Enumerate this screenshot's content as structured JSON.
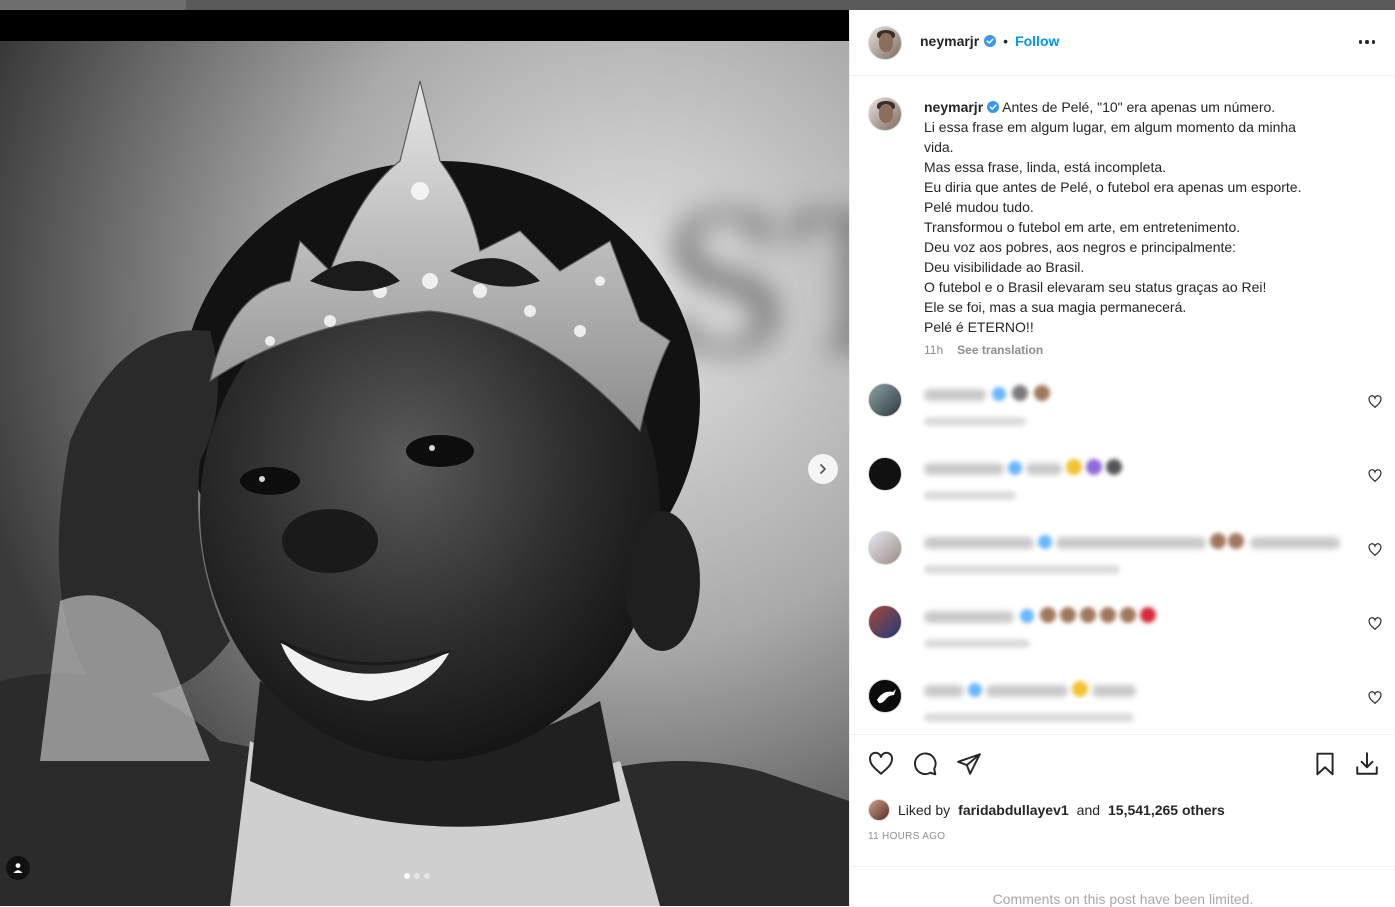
{
  "post": {
    "username": "neymarjr",
    "follow_label": "Follow",
    "separator": "•",
    "caption_lines": [
      "Antes de Pelé, \"10\" era apenas um número.",
      "Li essa frase em algum lugar, em algum momento da minha",
      "vida.",
      "Mas essa frase, linda, está incompleta.",
      "Eu diria que antes de Pelé, o futebol era apenas um esporte.",
      "Pelé mudou tudo.",
      "Transformou o futebol em arte, em entretenimento.",
      "Deu voz aos pobres, aos negros e principalmente:",
      "Deu visibilidade ao Brasil.",
      "O futebol e o Brasil elevaram seu status graças ao Rei!",
      "Ele se foi, mas a sua magia permanecerá.",
      "Pelé é ETERNO!!"
    ],
    "caption_time": "11h",
    "see_translation": "See translation",
    "liked_prefix": "Liked by",
    "liked_user": "faridabdullayev1",
    "liked_and": "and",
    "liked_count": "15,541,265 others",
    "time_ago": "11 HOURS AGO",
    "comments_limited": "Comments on this post have been limited."
  },
  "media": {
    "carousel_total": 3,
    "carousel_active": 1
  },
  "comments": [
    {
      "blurred": true,
      "emoji_colors": [
        "#7b7b7b",
        "#a0775d"
      ]
    },
    {
      "blurred": true,
      "emoji_colors": [
        "#f2c230",
        "#8e6ad8",
        "#555555"
      ]
    },
    {
      "blurred": true,
      "emoji_colors": [
        "#a0775d",
        "#a0775d"
      ]
    },
    {
      "blurred": true,
      "emoji_colors": [
        "#a0775d",
        "#a0775d",
        "#d62b3a"
      ]
    },
    {
      "blurred": true,
      "emoji_colors": [
        "#f2c230"
      ]
    }
  ],
  "colors": {
    "accent": "#0095f6",
    "text": "#262626",
    "muted": "#8e8e8e",
    "verified": "#3897f0"
  },
  "icons": {
    "like": "heart-icon",
    "comment": "comment-bubble-icon",
    "share": "paper-plane-icon",
    "save": "bookmark-icon",
    "download": "download-icon",
    "more": "more-options-icon",
    "next": "chevron-right-icon",
    "tags": "user-tag-icon"
  }
}
